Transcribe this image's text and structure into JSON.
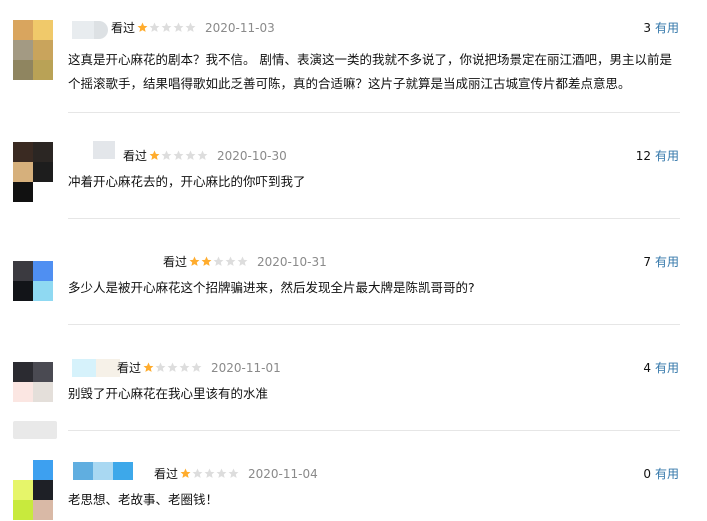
{
  "reviews": [
    {
      "watched_label": "看过",
      "rating": "1/5",
      "date": "2020-11-03",
      "votes": "3",
      "vote_label": "有用",
      "text": "这真是开心麻花的剧本？我不信。 剧情、表演这一类的我就不多说了，你说把场景定在丽江酒吧，男主以前是个摇滚歌手，结果唱得歌如此乏善可陈，真的合适嘛？这片子就算是当成丽江古城宣传片都差点意思。"
    },
    {
      "watched_label": "看过",
      "rating": "1/5",
      "date": "2020-10-30",
      "votes": "12",
      "vote_label": "有用",
      "text": "冲着开心麻花去的，开心麻比的你吓到我了"
    },
    {
      "watched_label": "看过",
      "rating": "2/5",
      "date": "2020-10-31",
      "votes": "7",
      "vote_label": "有用",
      "text": "多少人是被开心麻花这个招牌骗进来，然后发现全片最大牌是陈凯哥哥的?"
    },
    {
      "watched_label": "看过",
      "rating": "1/5",
      "date": "2020-11-01",
      "votes": "4",
      "vote_label": "有用",
      "text": "别毁了开心麻花在我心里该有的水准"
    },
    {
      "watched_label": "看过",
      "rating": "1/5",
      "date": "2020-11-04",
      "votes": "0",
      "vote_label": "有用",
      "text": "老思想、老故事、老圈钱！"
    }
  ],
  "colors": {
    "accent_link": "#3377aa",
    "star_filled": "#ffac2d",
    "star_empty": "#dddddd",
    "date": "#8a8a8a",
    "divider": "#e6e6e6"
  },
  "icons": {
    "star": "star-icon"
  }
}
